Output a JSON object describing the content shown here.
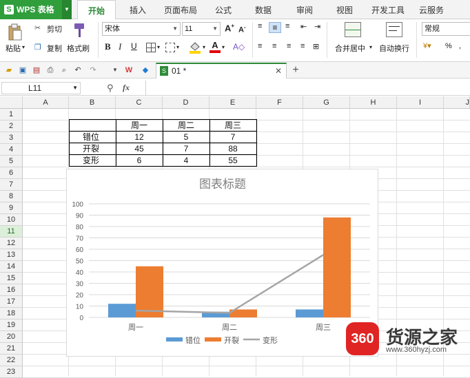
{
  "app": {
    "name": "WPS 表格"
  },
  "tabs": [
    "开始",
    "插入",
    "页面布局",
    "公式",
    "数据",
    "审阅",
    "视图",
    "开发工具",
    "云服务"
  ],
  "ribbon": {
    "paste": "粘贴",
    "cut": "剪切",
    "copy": "复制",
    "format_painter": "格式刷",
    "font_name": "宋体",
    "font_size": "11",
    "merge_center": "合并居中",
    "wrap_text": "自动换行",
    "number_format": "常规",
    "percent": "%",
    "comma": ","
  },
  "doc_tab": {
    "name": "01 *"
  },
  "formula_bar": {
    "cell_ref": "L11",
    "fx": "fx",
    "value": ""
  },
  "columns": [
    "A",
    "B",
    "C",
    "D",
    "E",
    "F",
    "G",
    "H",
    "I",
    "J"
  ],
  "rows": [
    "1",
    "2",
    "3",
    "4",
    "5",
    "6",
    "7",
    "8",
    "9",
    "10",
    "11",
    "12",
    "13",
    "14",
    "15",
    "16",
    "17",
    "18",
    "19",
    "20",
    "21",
    "22",
    "23"
  ],
  "selected_row": "11",
  "table": {
    "headers": [
      "",
      "周一",
      "周二",
      "周三"
    ],
    "rows": [
      [
        "错位",
        "12",
        "5",
        "7"
      ],
      [
        "开裂",
        "45",
        "7",
        "88"
      ],
      [
        "变形",
        "6",
        "4",
        "55"
      ]
    ]
  },
  "chart_data": {
    "type": "bar",
    "title": "图表标题",
    "categories": [
      "周一",
      "周二",
      "周三"
    ],
    "series": [
      {
        "name": "错位",
        "type": "bar",
        "color": "#5b9bd5",
        "values": [
          12,
          5,
          7
        ]
      },
      {
        "name": "开裂",
        "type": "bar",
        "color": "#ed7d31",
        "values": [
          45,
          7,
          88
        ]
      },
      {
        "name": "变形",
        "type": "line",
        "color": "#a5a5a5",
        "values": [
          6,
          4,
          55
        ]
      }
    ],
    "ylim": [
      0,
      100
    ],
    "yticks": [
      "0",
      "10",
      "20",
      "30",
      "40",
      "50",
      "60",
      "70",
      "80",
      "90",
      "100"
    ],
    "grid": true,
    "legend_position": "bottom"
  },
  "watermark": {
    "badge": "360",
    "site_name": "货源之家",
    "url": "www.360hyzj.com"
  },
  "colors": {
    "accent": "#2e8b38",
    "bar_blue": "#5b9bd5",
    "bar_orange": "#ed7d31",
    "line_gray": "#a5a5a5"
  }
}
